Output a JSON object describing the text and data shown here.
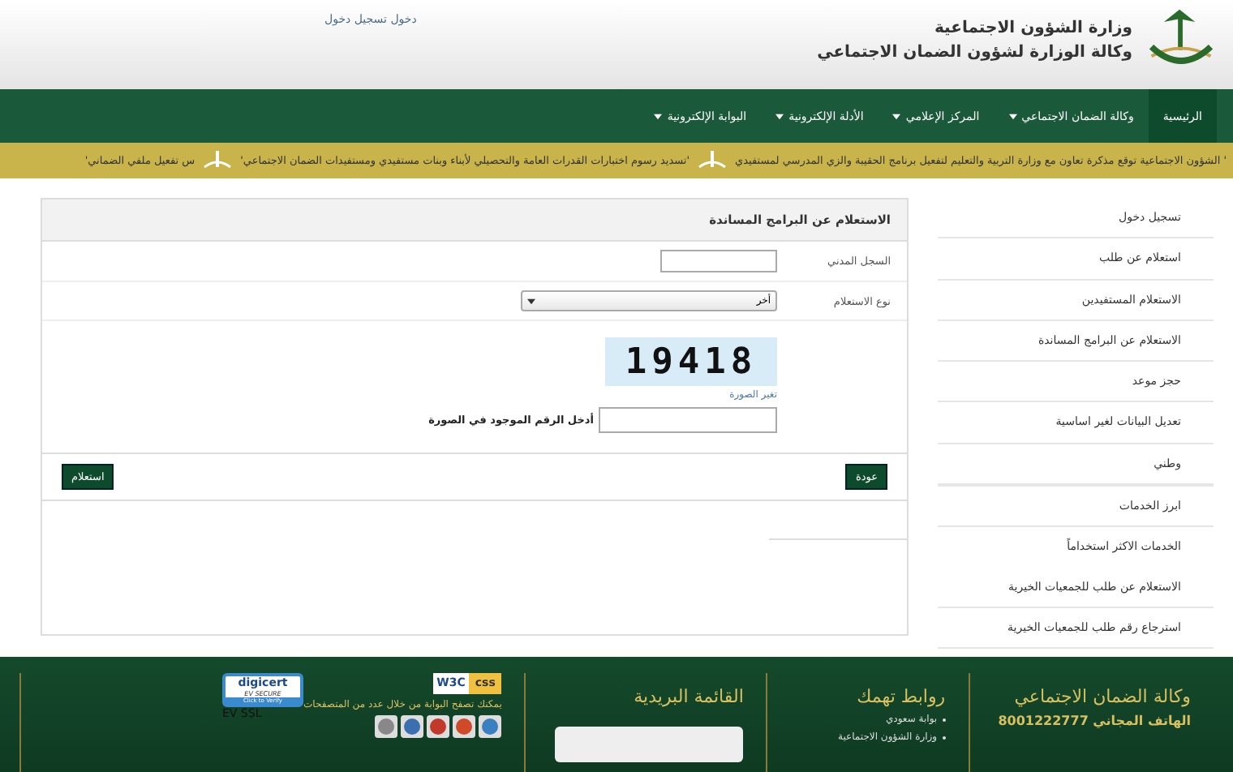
{
  "header": {
    "title": "وزارة الشؤون الاجتماعية",
    "subtitle": "وكالة الوزارة لشؤون الضمان الاجتماعي",
    "login_link": "دخول تسجيل دخول"
  },
  "nav": [
    {
      "label": "الرئيسية",
      "selected": true,
      "dropdown": false
    },
    {
      "label": "وكالة الضمان الاجتماعي",
      "selected": false,
      "dropdown": true
    },
    {
      "label": "المركز الإعلامي",
      "selected": false,
      "dropdown": true
    },
    {
      "label": "الأدلة الإلكترونية",
      "selected": false,
      "dropdown": true
    },
    {
      "label": "البوابة الإلكترونية",
      "selected": false,
      "dropdown": true
    }
  ],
  "ticker": [
    "' الشؤون الاجتماعية توقع مذكرة تعاون مع وزارة التربية والتعليم لتفعيل برنامج الحقيبة والزي المدرسي لمستفيدي",
    "'تسديد رسوم اختبارات القدرات العامة والتحصيلي لأبناء وبنات مستفيدي ومستفيدات الضمان الاجتماعي'",
    "س تفعيل ملفي الضماني'"
  ],
  "form": {
    "title": "الاستعلام عن البرامج المساندة",
    "id_label": "السجل المدني",
    "type_label": "نوع الاستعلام",
    "type_value": "أخر",
    "captcha": "19418",
    "change_image": "تغير الصورة",
    "captcha_label": "أدخل الرقم الموجود في الصورة",
    "back_button": "عودة",
    "submit_button": "استعلام"
  },
  "sidebar": [
    {
      "label": "تسجيل دخول",
      "kind": "link"
    },
    {
      "label": "استعلام عن طلب",
      "kind": "link"
    },
    {
      "label": "الاستعلام المستفيدين",
      "kind": "link"
    },
    {
      "label": "الاستعلام عن البرامج المساندة",
      "kind": "link"
    },
    {
      "label": "حجز موعد",
      "kind": "link"
    },
    {
      "label": "تعديل البيانات لغير اساسية",
      "kind": "link"
    },
    {
      "label": "وطني",
      "kind": "link"
    },
    {
      "label": "ابرز الخدمات",
      "kind": "heading"
    },
    {
      "label": "الخدمات الاكثر استخداماً",
      "kind": "heading"
    },
    {
      "label": "الاستعلام عن طلب للجمعيات الخيرية",
      "kind": "link"
    },
    {
      "label": "استرجاع رقم طلب للجمعيات الخيرية",
      "kind": "link"
    }
  ],
  "footer": {
    "agency": "وكالة الضمان الاجتماعي",
    "phone_label": "الهاتف المجاني",
    "phone": "8001222777",
    "links_title": "روابط تهمك",
    "links": [
      "بوابة سعودي",
      "وزارة الشؤون الاجتماعية"
    ],
    "mailing_title": "القائمة البريدية",
    "browsers_text": "يمكنك تصفح البوابة من خلال عدد من المتصفحات",
    "digicert": "digicert",
    "ev_secure": "EV SECURE",
    "verify": "Click to Verify",
    "ev_ssl": "EV SSL",
    "w3c": "W3C",
    "css": "css"
  }
}
